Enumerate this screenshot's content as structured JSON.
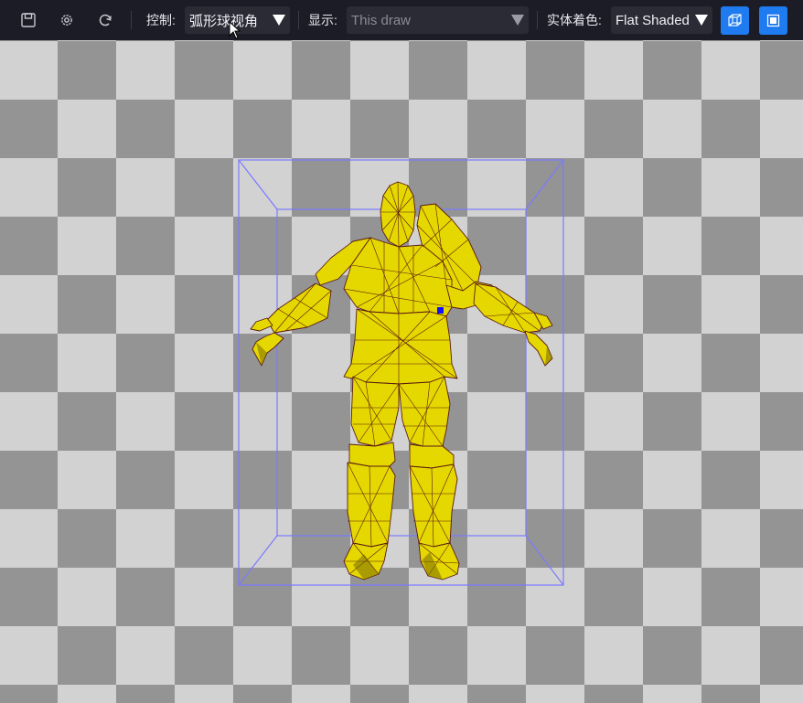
{
  "toolbar": {
    "icons": {
      "save": "save-icon",
      "settings": "gear-icon",
      "refresh": "refresh-icon"
    },
    "control_label": "控制:",
    "control_value": "弧形球视角",
    "display_label": "显示:",
    "display_placeholder": "This draw",
    "shading_label": "实体着色:",
    "shading_value": "Flat Shaded",
    "wireframe_button_icon": "wireframe-cube-icon",
    "solid_button_icon": "solid-square-icon"
  },
  "viewport": {
    "background": "checkerboard",
    "checker_light": "#d2d2d2",
    "checker_dark": "#949494",
    "model": "yellow-armored-humanoid-wireframe",
    "model_fill": "#e5d800",
    "model_edge": "#5a1a10",
    "bounding_box_color": "#7a7aff",
    "marker_color": "#1010ff"
  },
  "colors": {
    "toolbar_bg": "#1b1c26",
    "accent": "#1e7bf0"
  }
}
